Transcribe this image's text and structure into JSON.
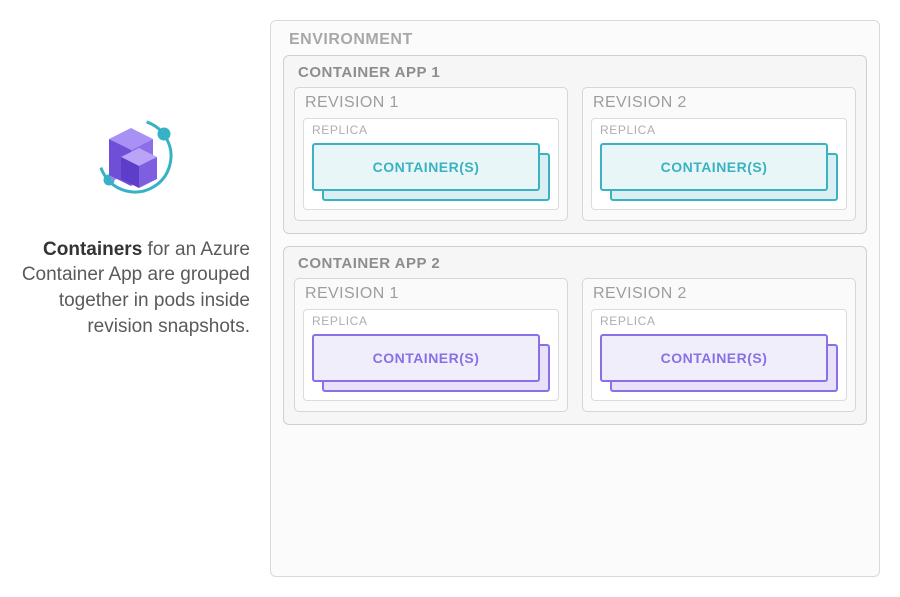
{
  "description": {
    "bold": "Containers",
    "rest": " for an Azure Container App are grouped together in pods inside revision snapshots."
  },
  "environment": {
    "label": "ENVIRONMENT",
    "apps": [
      {
        "label": "CONTAINER APP 1",
        "theme": "teal",
        "revisions": [
          {
            "label": "REVISION 1",
            "replica_label": "REPLICA",
            "container_label": "CONTAINER(S)"
          },
          {
            "label": "REVISION 2",
            "replica_label": "REPLICA",
            "container_label": "CONTAINER(S)"
          }
        ]
      },
      {
        "label": "CONTAINER APP 2",
        "theme": "purple",
        "revisions": [
          {
            "label": "REVISION 1",
            "replica_label": "REPLICA",
            "container_label": "CONTAINER(S)"
          },
          {
            "label": "REVISION 2",
            "replica_label": "REPLICA",
            "container_label": "CONTAINER(S)"
          }
        ]
      }
    ]
  }
}
